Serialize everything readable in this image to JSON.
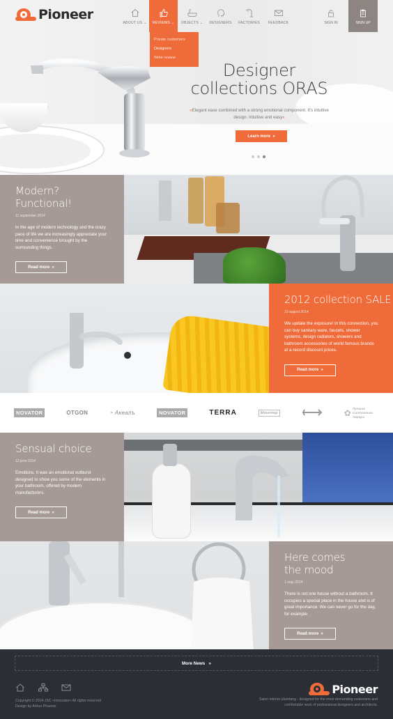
{
  "brand": {
    "name": "Pioneer",
    "accent": "#ef6b3a",
    "panel_color": "#a69a96"
  },
  "nav": {
    "items": [
      {
        "label": "About us",
        "icon": "home-icon"
      },
      {
        "label": "Reviews",
        "icon": "thumbs-up-icon"
      },
      {
        "label": "Objects",
        "icon": "bathtub-icon"
      },
      {
        "label": "Designers",
        "icon": "head-icon"
      },
      {
        "label": "Factories",
        "icon": "faucet-icon"
      },
      {
        "label": "Feedback",
        "icon": "envelope-icon"
      }
    ],
    "sign_in": "Sign in",
    "sign_up": "Sign up"
  },
  "reviews_menu": [
    "Private customers",
    "Designers",
    "Write review"
  ],
  "hero": {
    "title_line1": "Designer",
    "title_line2": "collections ORAS",
    "subtitle": "Elegant ease combined with a strong emotional component. It's intuitive design. Intuitive and easy",
    "button": "Learn more"
  },
  "posts": [
    {
      "title": "Modern? Functional!",
      "date": "11 september 2014",
      "text": "In the age of modern technology and the crazy pace of life we are increasingly appreciate your time and convenience brought by the surrounding things.",
      "button": "Read more"
    },
    {
      "title": "2012 collection SALE",
      "date": "19 august 2014",
      "text": "We update the exposure! In this connection, you can buy sanitary ware, faucets, shower systems, design radiators, showers and bathroom accessories of world famous brands at a record discount prices.",
      "button": "Read more"
    },
    {
      "title": "Sensual choice",
      "date": "12 june 2014",
      "text": "Emotions. It was an emotional outburst designed to show you some of the elements in your bathroom, offered by modern manufacturers.",
      "button": "Read more"
    },
    {
      "title": "Here comes the mood",
      "date": "1 may 2014",
      "text": "There is not one house without a bathroom. It occupies a special place in the house and is of great importance. We can never go for the day, for example.",
      "button": "Read more"
    }
  ],
  "brands": [
    "NOVATOR",
    "OTGON",
    "Акеалъ",
    "NOVATOR",
    "TERRA",
    "Монопор",
    "",
    "Лучшие Сантехники Аврора"
  ],
  "footer": {
    "more_news": "More News",
    "copyright": "Copyright © 2014 JSC «Innovator» All rights reserved",
    "design_by": "Design by Arthur Phoenix",
    "description": "Salon interior plumbing - designed for the most demanding customers and comfortable work of professional designers and architects."
  }
}
